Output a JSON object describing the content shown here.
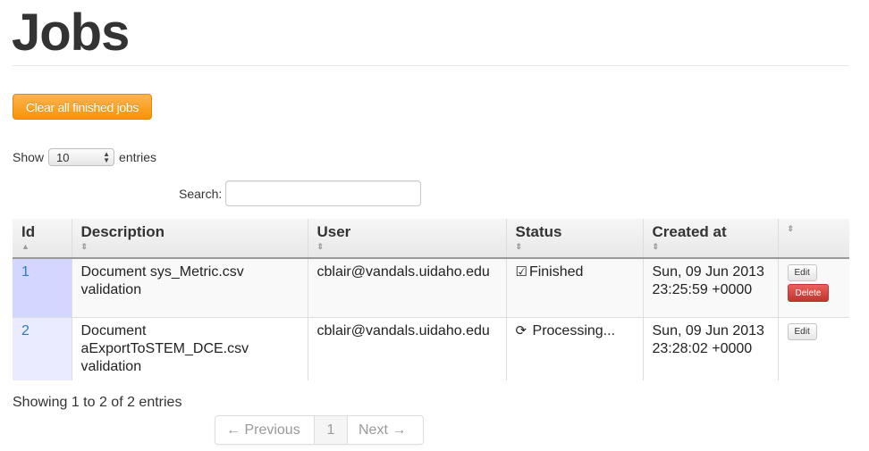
{
  "page": {
    "title": "Jobs"
  },
  "toolbar": {
    "clear_label": "Clear all finished jobs"
  },
  "length_menu": {
    "prefix": "Show",
    "value": "10",
    "suffix": "entries"
  },
  "search": {
    "label": "Search:",
    "value": ""
  },
  "table": {
    "columns": [
      "Id",
      "Description",
      "User",
      "Status",
      "Created at",
      ""
    ],
    "rows": [
      {
        "id": "1",
        "description": "Document sys_Metric.csv validation",
        "user": "cblair@vandals.uidaho.edu",
        "status": "Finished",
        "status_icon": "check-square-icon",
        "created": "Sun, 09 Jun 2013 23:25:59 +0000",
        "edit_label": "Edit",
        "delete_label": "Delete"
      },
      {
        "id": "2",
        "description": "Document aExportToSTEM_DCE.csv validation",
        "user": "cblair@vandals.uidaho.edu",
        "status": "Processing...",
        "status_icon": "refresh-icon",
        "created": "Sun, 09 Jun 2013 23:28:02 +0000",
        "edit_label": "Edit"
      }
    ]
  },
  "info": "Showing 1 to 2 of 2 entries",
  "pagination": {
    "previous": "← Previous",
    "current": "1",
    "next": "Next →"
  },
  "colors": {
    "accent": "#f89406",
    "danger": "#bd362f",
    "link": "#2f7bbf"
  }
}
